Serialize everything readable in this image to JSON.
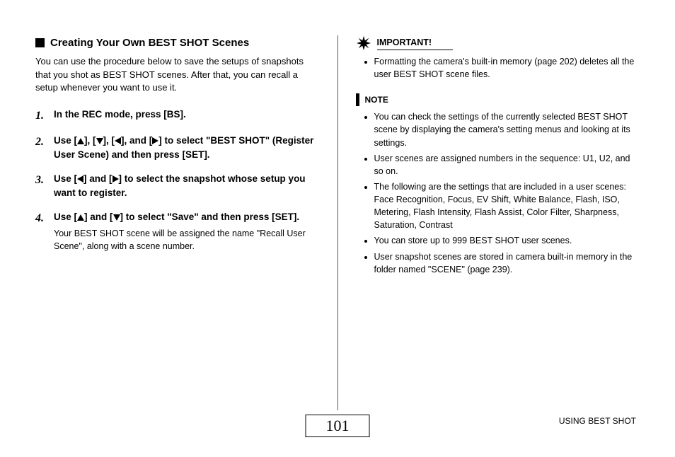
{
  "left": {
    "heading": "Creating Your Own BEST SHOT Scenes",
    "intro": "You can use the procedure below to save the setups of snapshots that you shot as BEST SHOT scenes. After that, you can recall a setup whenever you want to use it.",
    "steps": [
      {
        "num": "1.",
        "bold_pre": "In the REC mode, press [BS].",
        "bold_post": "",
        "arrows": [],
        "sub": ""
      },
      {
        "num": "2.",
        "bold_pre": "Use [",
        "bold_mid1": "], [",
        "bold_mid2": "], [",
        "bold_mid3": "], and [",
        "bold_post": "] to select \"BEST SHOT\" (Register User Scene) and then press [SET].",
        "arrows": [
          "up",
          "down",
          "left",
          "right"
        ],
        "sub": ""
      },
      {
        "num": "3.",
        "bold_pre": "Use [",
        "bold_mid1": "] and [",
        "bold_post": "] to select the snapshot whose setup you want to register.",
        "arrows": [
          "left",
          "right"
        ],
        "sub": ""
      },
      {
        "num": "4.",
        "bold_pre": "Use [",
        "bold_mid1": "] and [",
        "bold_post": "] to select \"Save\" and then press [SET].",
        "arrows": [
          "up",
          "down"
        ],
        "sub": "Your BEST SHOT scene will be assigned the name \"Recall User Scene\", along with a scene number."
      }
    ]
  },
  "right": {
    "important_label": "IMPORTANT!",
    "important_items": [
      "Formatting the camera's built-in memory (page 202) deletes all the user BEST SHOT scene files."
    ],
    "note_label": "NOTE",
    "note_items": [
      {
        "text": "You can check the settings of the currently selected BEST SHOT scene by displaying the camera's setting menus and looking at its settings.",
        "sub": ""
      },
      {
        "text": "User scenes are assigned numbers in the sequence: U1, U2, and so on.",
        "sub": ""
      },
      {
        "text": "The following are the settings that are included in a user scenes:",
        "sub": "Face Recognition, Focus, EV Shift, White Balance, Flash, ISO, Metering, Flash Intensity, Flash Assist, Color Filter, Sharpness, Saturation, Contrast"
      },
      {
        "text": "You can store up to 999 BEST SHOT user scenes.",
        "sub": ""
      },
      {
        "text": "User snapshot scenes are stored in camera built-in memory in the folder named \"SCENE\" (page 239).",
        "sub": ""
      }
    ]
  },
  "footer": {
    "page_number": "101",
    "section": "USING BEST SHOT"
  }
}
